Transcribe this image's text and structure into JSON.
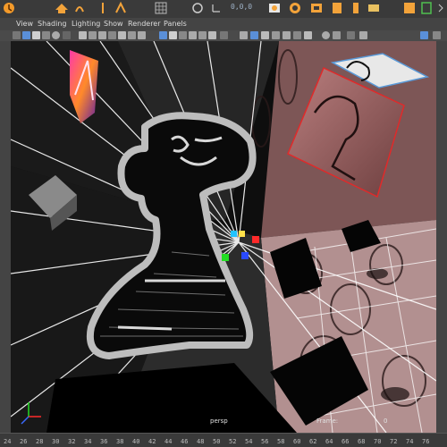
{
  "shelf": {
    "coords": "0,0,0",
    "icons": [
      "timeline-icon",
      "move-tool-icon",
      "rotate-tool-icon",
      "curve-tool-icon",
      "camera-icon",
      "grid-snap-icon",
      "magnet-snap-icon",
      "axis-icon",
      "render-icon",
      "ipr-icon",
      "render-settings-icon",
      "outliner-icon",
      "attribute-editor-icon",
      "channel-box-icon"
    ]
  },
  "menu": {
    "items": [
      "View",
      "Shading",
      "Lighting",
      "Show",
      "Renderer",
      "Panels"
    ]
  },
  "viewport": {
    "camera": "persp",
    "frame_label": "Frame:",
    "frame_value": "0"
  },
  "timeline": {
    "frames": [
      "24",
      "26",
      "28",
      "30",
      "32",
      "34",
      "36",
      "38",
      "40",
      "42",
      "44",
      "46",
      "48",
      "50",
      "52",
      "54",
      "56",
      "58",
      "60",
      "62",
      "64",
      "66",
      "68",
      "70",
      "72",
      "74",
      "76"
    ]
  },
  "colors": {
    "accent": "#f3a33a",
    "selection": "#e02a2a",
    "menu_bg": "#444444",
    "viewport_bg": "#0e0e0e"
  }
}
